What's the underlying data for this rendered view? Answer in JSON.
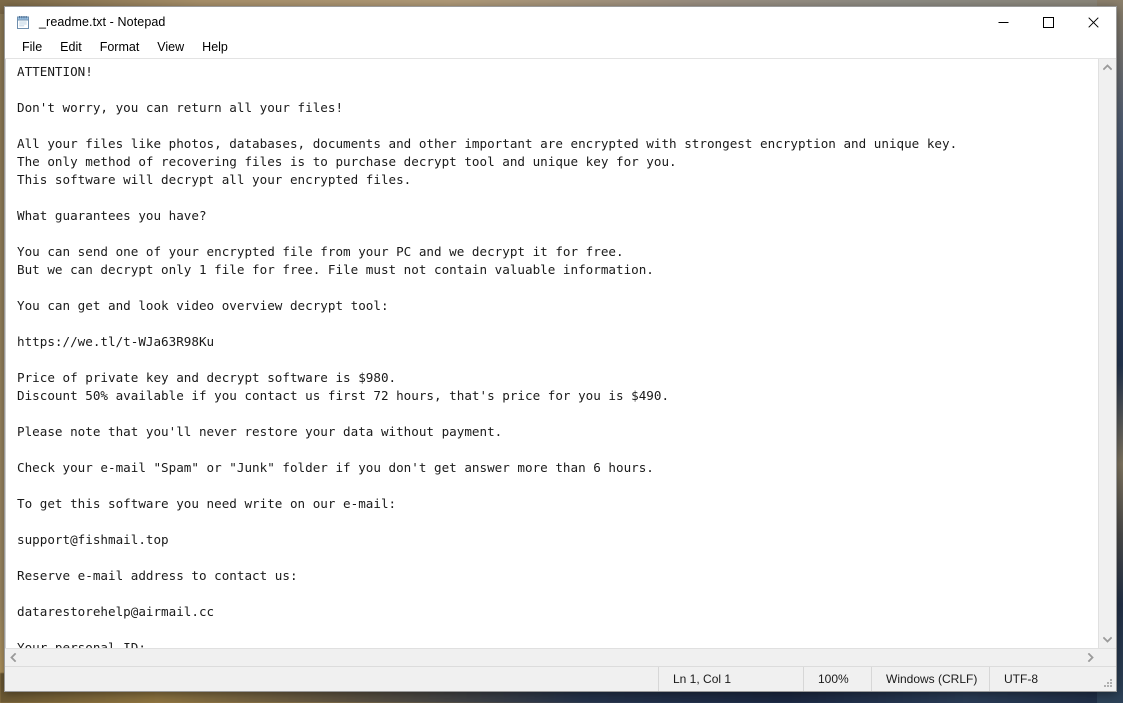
{
  "window": {
    "title": "_readme.txt - Notepad",
    "app_icon": "notepad-icon",
    "controls": {
      "minimize": "—",
      "maximize": "□",
      "close": "✕"
    }
  },
  "menubar": {
    "items": [
      {
        "label": "File"
      },
      {
        "label": "Edit"
      },
      {
        "label": "Format"
      },
      {
        "label": "View"
      },
      {
        "label": "Help"
      }
    ]
  },
  "document": {
    "filename": "_readme.txt",
    "body": "ATTENTION!\n\nDon't worry, you can return all your files!\n\nAll your files like photos, databases, documents and other important are encrypted with strongest encryption and unique key.\nThe only method of recovering files is to purchase decrypt tool and unique key for you.\nThis software will decrypt all your encrypted files.\n\nWhat guarantees you have?\n\nYou can send one of your encrypted file from your PC and we decrypt it for free.\nBut we can decrypt only 1 file for free. File must not contain valuable information.\n\nYou can get and look video overview decrypt tool:\n\nhttps://we.tl/t-WJa63R98Ku\n\nPrice of private key and decrypt software is $980.\nDiscount 50% available if you contact us first 72 hours, that's price for you is $490.\n\nPlease note that you'll never restore your data without payment.\n\nCheck your e-mail \"Spam\" or \"Junk\" folder if you don't get answer more than 6 hours.\n\nTo get this software you need write on our e-mail:\n\nsupport@fishmail.top\n\nReserve e-mail address to contact us:\n\ndatarestorehelp@airmail.cc\n\nYour personal ID:",
    "ransom_details": {
      "video_url": "https://we.tl/t-WJa63R98Ku",
      "full_price": "$980",
      "discounted_price": "$490",
      "discount": "50%",
      "discount_window_hours": "72",
      "response_time_hours": "6",
      "primary_email": "support@fishmail.top",
      "reserve_email": "datarestorehelp@airmail.cc"
    }
  },
  "scrollbars": {
    "vertical": {
      "up_arrow": "⌃",
      "down_arrow": "⌄"
    },
    "horizontal": {
      "left_arrow": "‹",
      "right_arrow": "›"
    }
  },
  "statusbar": {
    "cursor_position": "Ln 1, Col 1",
    "zoom": "100%",
    "line_ending": "Windows (CRLF)",
    "encoding": "UTF-8"
  },
  "colors": {
    "window_bg": "#f0f0f0",
    "text_bg": "#ffffff",
    "text_fg": "#1a1a1a",
    "close_hover": "#e81123"
  }
}
